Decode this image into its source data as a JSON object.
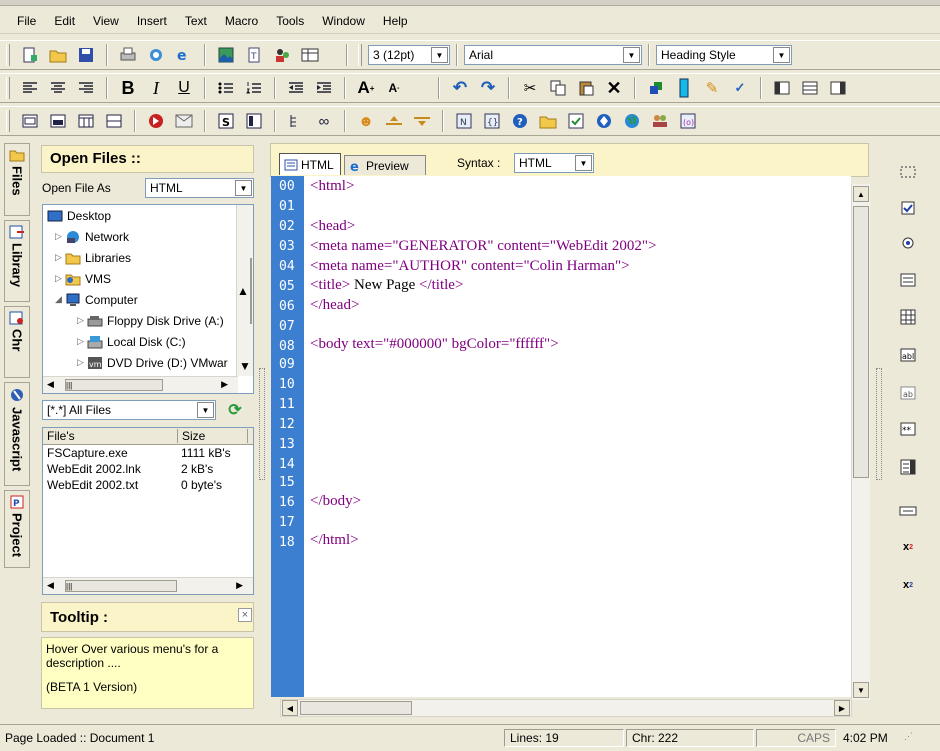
{
  "menu": [
    "File",
    "Edit",
    "View",
    "Insert",
    "Text",
    "Macro",
    "Tools",
    "Window",
    "Help"
  ],
  "toolbar": {
    "font_size": "3 (12pt)",
    "font_family": "Arial",
    "style": "Heading Style"
  },
  "sidebar_tabs": [
    "Files",
    "Library",
    "Chr",
    "Javascript",
    "Project"
  ],
  "files_panel": {
    "title": "Open Files ::",
    "open_as_label": "Open File As",
    "open_as_value": "HTML",
    "tree": [
      {
        "label": "Desktop",
        "indent": 0
      },
      {
        "label": "Network",
        "indent": 1
      },
      {
        "label": "Libraries",
        "indent": 1
      },
      {
        "label": "VMS",
        "indent": 1
      },
      {
        "label": "Computer",
        "indent": 1
      },
      {
        "label": "Floppy Disk Drive (A:)",
        "indent": 2
      },
      {
        "label": "Local Disk (C:)",
        "indent": 2
      },
      {
        "label": "DVD Drive (D:) VMwar",
        "indent": 2
      }
    ],
    "filter": "[*.*] All Files",
    "columns": [
      "File's",
      "Size"
    ],
    "files": [
      {
        "name": "FSCapture.exe",
        "size": "1111 kB's"
      },
      {
        "name": "WebEdit 2002.lnk",
        "size": "2 kB's"
      },
      {
        "name": "WebEdit 2002.txt",
        "size": "0 byte's"
      }
    ]
  },
  "tooltip": {
    "title": "Tooltip :",
    "line1": "Hover Over various menu's  for a description ....",
    "line2": "(BETA 1 Version)"
  },
  "editor": {
    "tabs": [
      "HTML",
      "Preview"
    ],
    "syntax_label": "Syntax :",
    "syntax_value": "HTML",
    "line_numbers": [
      "00",
      "01",
      "02",
      "03",
      "04",
      "05",
      "06",
      "07",
      "08",
      "09",
      "10",
      "11",
      "12",
      "13",
      "14",
      "15",
      "16",
      "17",
      "18"
    ],
    "code": {
      "l00": "<html>",
      "l02": "<head>",
      "l03a": "<meta",
      "l03b": " name=",
      "l03c": "\"GENERATOR\"",
      "l03d": " content=",
      "l03e": "\"WebEdit 2002\"",
      "l03f": ">",
      "l04a": "<meta",
      "l04b": " name=",
      "l04c": "\"AUTHOR\"",
      "l04d": " content=",
      "l04e": "\"Colin Harman\"",
      "l04f": ">",
      "l05a": "<title>",
      "l05b": " New Page ",
      "l05c": "</title>",
      "l06": "</head>",
      "l08a": "<body",
      "l08b": " text=",
      "l08c": "\"#000000\"",
      "l08d": " bgColor=",
      "l08e": "\"ffffff\"",
      "l08f": ">",
      "l16": "</body>",
      "l18": "</html>"
    }
  },
  "status": {
    "message": "Page Loaded ::  Document 1",
    "lines": "Lines: 19",
    "chr": "Chr: 222",
    "caps": "CAPS",
    "time": "4:02 PM"
  },
  "colors": {
    "gutter": "#3c7fd0",
    "tag": "#800080",
    "panel_title_bg": "#fbf4c8"
  }
}
